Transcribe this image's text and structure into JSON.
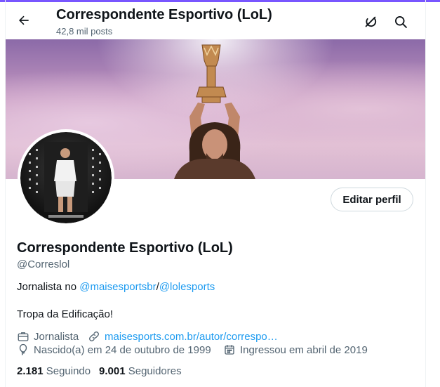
{
  "header": {
    "title": "Correspondente Esportivo (LoL)",
    "posts_count": "42,8 mil posts"
  },
  "profile": {
    "edit_button": "Editar perfil",
    "name": "Correspondente Esportivo (LoL)",
    "handle": "@Correslol",
    "bio": {
      "line1_prefix": "Jornalista no ",
      "mention1": "@maisesportsbr",
      "separator": "/",
      "mention2": "@lolesports",
      "line2": "Tropa da Edificação!"
    },
    "meta": {
      "profession": "Jornalista",
      "website": "maisesports.com.br/autor/correspo…",
      "birthday": "Nascido(a) em 24 de outubro de 1999",
      "joined": "Ingressou em abril de 2019"
    },
    "stats": {
      "following_count": "2.181",
      "following_label": "Seguindo",
      "followers_count": "9.001",
      "followers_label": "Seguidores"
    }
  },
  "colors": {
    "accent": "#7856ff",
    "link": "#1d9bf0",
    "secondary_text": "#536471"
  }
}
